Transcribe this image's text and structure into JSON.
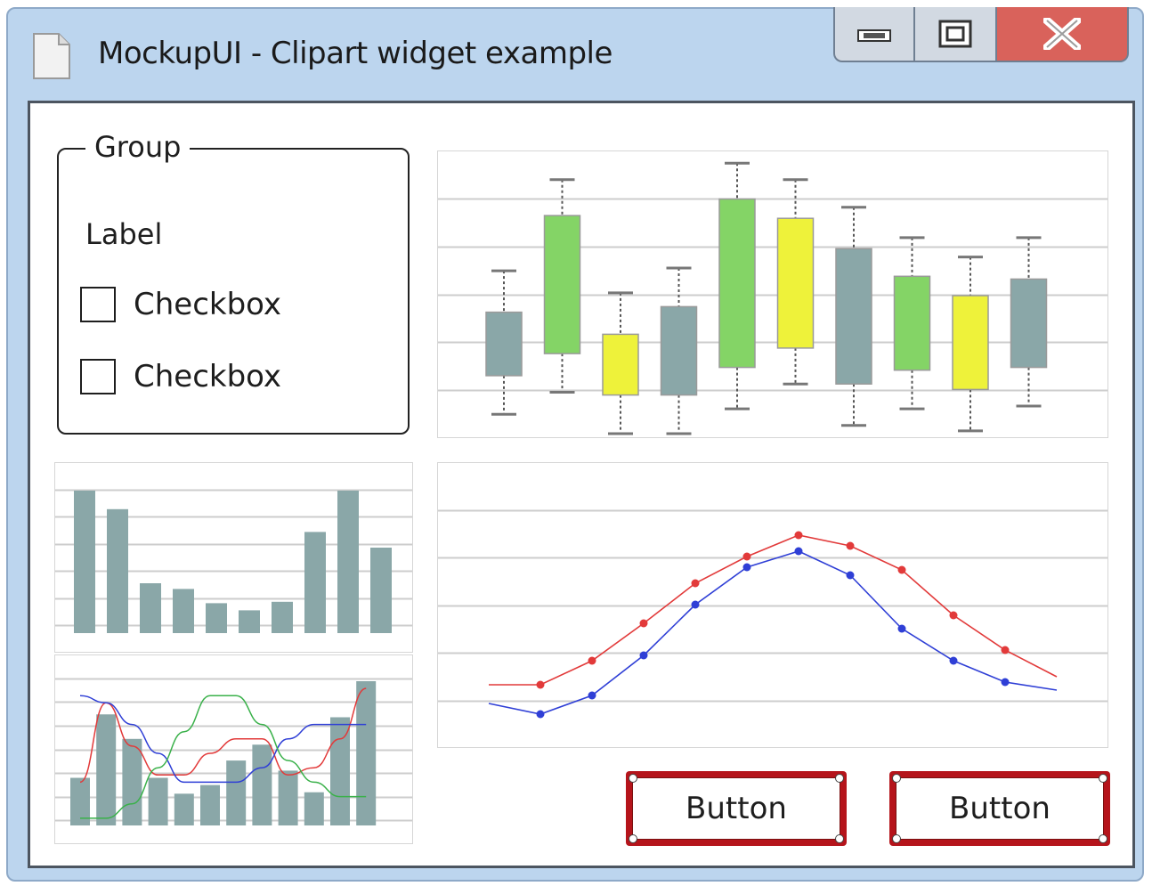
{
  "window": {
    "title": "MockupUI - Clipart widget example",
    "controls": {
      "minimize": "minimize-icon",
      "maximize": "maximize-icon",
      "close": "close-icon"
    }
  },
  "group": {
    "title": "Group",
    "label": "Label",
    "checkboxes": [
      {
        "label": "Checkbox",
        "checked": false
      },
      {
        "label": "Checkbox",
        "checked": false
      }
    ]
  },
  "buttons": [
    {
      "label": "Button"
    },
    {
      "label": "Button"
    }
  ],
  "chart_data": [
    {
      "type": "boxplot",
      "grid": true,
      "ylim": [
        0,
        100
      ],
      "colors": [
        "#8aa7a8",
        "#84d466",
        "#eef23a"
      ],
      "boxes": [
        {
          "color": "#8aa7a8",
          "min": 7,
          "q1": 21,
          "q3": 44,
          "max": 59
        },
        {
          "color": "#84d466",
          "min": 15,
          "q1": 29,
          "q3": 79,
          "max": 92
        },
        {
          "color": "#eef23a",
          "min": 0,
          "q1": 14,
          "q3": 36,
          "max": 51
        },
        {
          "color": "#8aa7a8",
          "min": 0,
          "q1": 14,
          "q3": 46,
          "max": 60
        },
        {
          "color": "#84d466",
          "min": 9,
          "q1": 24,
          "q3": 85,
          "max": 98
        },
        {
          "color": "#eef23a",
          "min": 18,
          "q1": 31,
          "q3": 78,
          "max": 92
        },
        {
          "color": "#8aa7a8",
          "min": 3,
          "q1": 18,
          "q3": 67,
          "max": 82
        },
        {
          "color": "#84d466",
          "min": 9,
          "q1": 23,
          "q3": 57,
          "max": 71
        },
        {
          "color": "#eef23a",
          "min": 1,
          "q1": 16,
          "q3": 50,
          "max": 64
        },
        {
          "color": "#8aa7a8",
          "min": 10,
          "q1": 24,
          "q3": 56,
          "max": 71
        }
      ]
    },
    {
      "type": "bar",
      "grid": true,
      "ylim": [
        0,
        100
      ],
      "color": "#8aa7a8",
      "values": [
        100,
        87,
        35,
        31,
        21,
        16,
        22,
        71,
        100,
        60
      ]
    },
    {
      "type": "bar+line",
      "grid": true,
      "ylim": [
        0,
        100
      ],
      "bar_color": "#8aa7a8",
      "bars": [
        33,
        77,
        60,
        33,
        22,
        28,
        45,
        56,
        38,
        23,
        75,
        100
      ],
      "series": [
        {
          "color": "#e23a3a",
          "values": [
            30,
            85,
            55,
            35,
            35,
            50,
            60,
            60,
            35,
            40,
            60,
            95
          ]
        },
        {
          "color": "#2f3fd6",
          "values": [
            90,
            85,
            70,
            50,
            30,
            30,
            30,
            40,
            60,
            70,
            70,
            70
          ]
        },
        {
          "color": "#3ab14a",
          "values": [
            5,
            5,
            15,
            40,
            65,
            90,
            90,
            70,
            45,
            30,
            20,
            20
          ]
        }
      ]
    },
    {
      "type": "line",
      "grid": true,
      "ylim": [
        0,
        100
      ],
      "markers": true,
      "series": [
        {
          "color": "#e23a3a",
          "values": [
            22,
            22,
            31,
            45,
            60,
            70,
            78,
            74,
            65,
            48,
            35,
            25
          ]
        },
        {
          "color": "#2f3fd6",
          "values": [
            15,
            11,
            18,
            33,
            52,
            66,
            72,
            63,
            43,
            31,
            23,
            20
          ]
        }
      ]
    }
  ]
}
